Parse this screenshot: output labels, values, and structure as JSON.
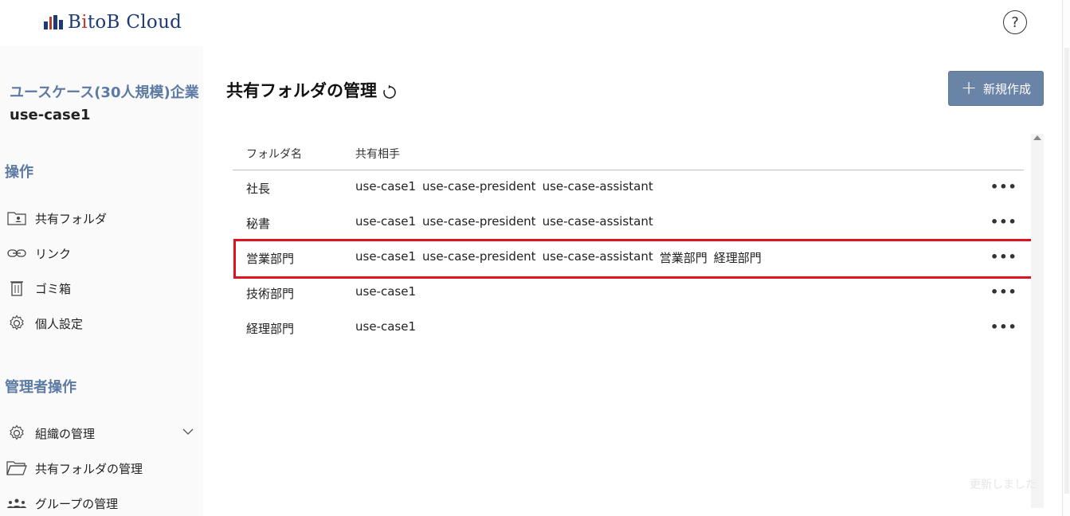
{
  "header": {
    "logo_text_1": "B",
    "logo_text_i": "i",
    "logo_text_2": "toB Cloud",
    "help_symbol": "?"
  },
  "sidebar": {
    "org_name": "ユースケース(30人規模)企業",
    "user_id": "use-case1",
    "section_ops": "操作",
    "ops_items": [
      {
        "label": "共有フォルダ",
        "icon": "shared-folder-icon"
      },
      {
        "label": "リンク",
        "icon": "link-icon"
      },
      {
        "label": "ゴミ箱",
        "icon": "trash-icon"
      },
      {
        "label": "個人設定",
        "icon": "gear-icon"
      }
    ],
    "section_admin": "管理者操作",
    "admin_items": [
      {
        "label": "組織の管理",
        "icon": "gear-icon"
      },
      {
        "label": "共有フォルダの管理",
        "icon": "folder-icon"
      },
      {
        "label": "グループの管理",
        "icon": "group-icon"
      }
    ]
  },
  "main": {
    "title": "共有フォルダの管理",
    "new_button": "新規作成",
    "table": {
      "col_folder": "フォルダ名",
      "col_shared": "共有相手",
      "rows": [
        {
          "name": "社長",
          "shared": [
            "use-case1",
            "use-case-president",
            "use-case-assistant"
          ]
        },
        {
          "name": "秘書",
          "shared": [
            "use-case1",
            "use-case-president",
            "use-case-assistant"
          ]
        },
        {
          "name": "営業部門",
          "shared": [
            "use-case1",
            "use-case-president",
            "use-case-assistant",
            "営業部門",
            "経理部門"
          ]
        },
        {
          "name": "技術部門",
          "shared": [
            "use-case1"
          ]
        },
        {
          "name": "経理部門",
          "shared": [
            "use-case1"
          ]
        }
      ],
      "more_symbol": "•••"
    },
    "toast": "更新しました"
  },
  "colors": {
    "brand": "#1d3a75",
    "accent": "#5c7aa3",
    "button": "#6a84a8",
    "highlight": "#e0121f"
  }
}
